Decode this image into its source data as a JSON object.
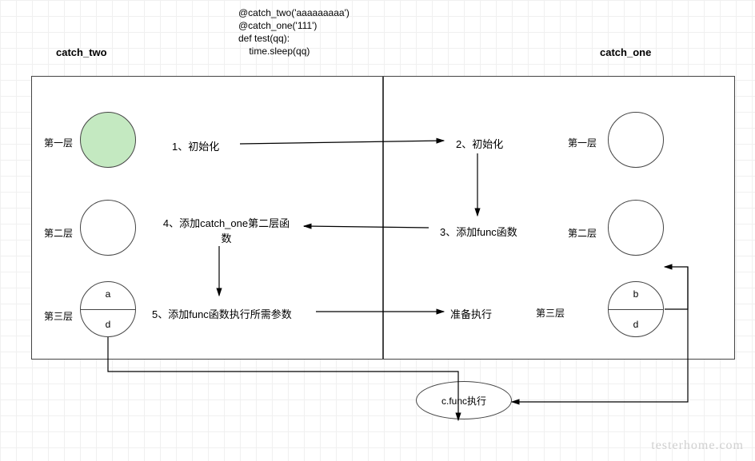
{
  "code": {
    "line1": "@catch_two('aaaaaaaaa')",
    "line2": "@catch_one('111')",
    "line3": "def test(qq):",
    "line4": "    time.sleep(qq)"
  },
  "titles": {
    "left": "catch_two",
    "right": "catch_one"
  },
  "layers": {
    "l1l": "第一层",
    "l2l": "第二层",
    "l3l": "第三层",
    "l1r": "第一层",
    "l2r": "第二层",
    "l3r": "第三层"
  },
  "steps": {
    "s1": "1、初始化",
    "s2": "2、初始化",
    "s3": "3、添加func函数",
    "s4": "4、添加catch_one第二层函数",
    "s5": "5、添加func函数执行所需参数",
    "s6": "准备执行"
  },
  "circle_left3": {
    "top": "a",
    "bottom": "d"
  },
  "circle_right3": {
    "top": "b",
    "bottom": "d"
  },
  "cfunc": "c.func执行",
  "watermark": "testerhome.com"
}
